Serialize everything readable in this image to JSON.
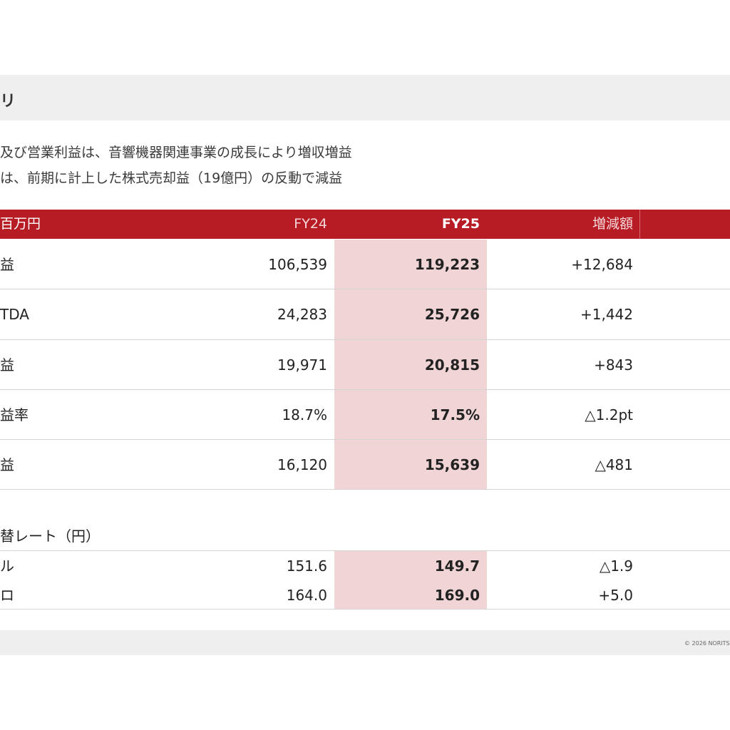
{
  "title": "リ",
  "summary": {
    "line1": "及び営業利益は、音響機器関連事業の成長により増収増益",
    "line2": "は、前期に計上した株式売却益（19億円）の反動で減益"
  },
  "table": {
    "headers": {
      "unit": "百万円",
      "fy24": "FY24",
      "fy25": "FY25",
      "diff": "増減額"
    },
    "rows": [
      {
        "label": "益",
        "fy24": "106,539",
        "fy25": "119,223",
        "diff": "+12,684"
      },
      {
        "label": "TDA",
        "fy24": "24,283",
        "fy25": "25,726",
        "diff": "+1,442"
      },
      {
        "label": "益",
        "fy24": "19,971",
        "fy25": "20,815",
        "diff": "+843"
      },
      {
        "label": "益率",
        "fy24": "18.7%",
        "fy25": "17.5%",
        "diff": "△1.2pt"
      },
      {
        "label": "益",
        "fy24": "16,120",
        "fy25": "15,639",
        "diff": "△481"
      }
    ]
  },
  "fx": {
    "title": "替レート（円）",
    "rows": [
      {
        "label": "ル",
        "fy24": "151.6",
        "fy25": "149.7",
        "diff": "△1.9"
      },
      {
        "label": "ロ",
        "fy24": "164.0",
        "fy25": "169.0",
        "diff": "+5.0"
      }
    ]
  },
  "footer": {
    "copyright": "© 2026 NORITS"
  },
  "colors": {
    "accent": "#b71c24",
    "highlight": "#f0d4d6",
    "band": "#efefef"
  }
}
